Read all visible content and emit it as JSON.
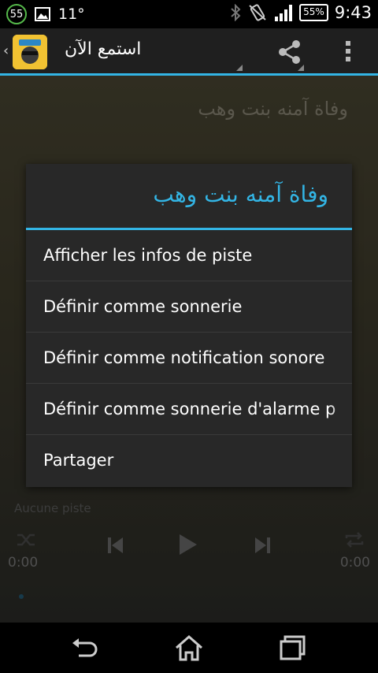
{
  "status_bar": {
    "notification_count": "55",
    "temperature": "11°",
    "battery": "55%",
    "time": "9:43"
  },
  "action_bar": {
    "title": "استمع الآن"
  },
  "content": {
    "track_title": "وفاة آمنه بنت وهب"
  },
  "dialog": {
    "title": "وفاة آمنه بنت وهب",
    "items": [
      {
        "label": "Afficher les infos de piste"
      },
      {
        "label": "Définir comme sonnerie"
      },
      {
        "label": "Définir comme notification sonore"
      },
      {
        "label": "Définir comme sonnerie d'alarme p"
      },
      {
        "label": "Partager"
      }
    ]
  },
  "player": {
    "status": "Aucune piste",
    "elapsed": "0:00",
    "duration": "0:00"
  },
  "colors": {
    "accent": "#33b5e5",
    "dialog_bg": "#282828",
    "actionbar_bg": "#1f1f1f"
  }
}
